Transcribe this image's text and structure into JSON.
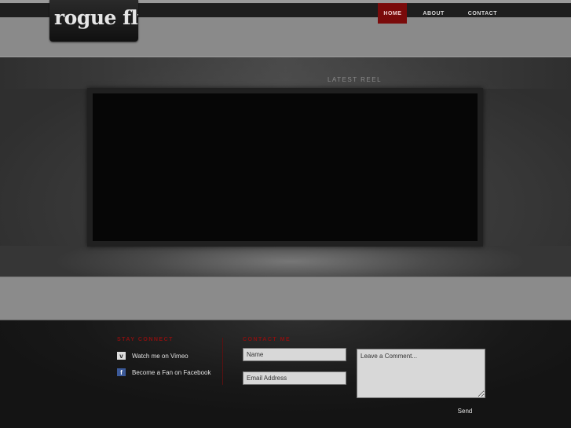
{
  "logo": {
    "text": "rogue fly"
  },
  "nav": {
    "items": [
      {
        "label": "HOME"
      },
      {
        "label": "ABOUT"
      },
      {
        "label": "CONTACT"
      }
    ]
  },
  "reel": {
    "title": "LATEST REEL"
  },
  "footer": {
    "stay_connect": {
      "heading": "STAY CONNECT",
      "vimeo_label": "Watch me on Vimeo",
      "facebook_label": "Become a Fan on Facebook"
    },
    "contact": {
      "heading": "CONTACT ME",
      "name_placeholder": "Name",
      "email_placeholder": "Email Address",
      "comment_placeholder": "Leave a Comment...",
      "send_label": "Send"
    }
  },
  "colors": {
    "accent": "#7a0b0b",
    "heading_red": "#8a1010"
  }
}
